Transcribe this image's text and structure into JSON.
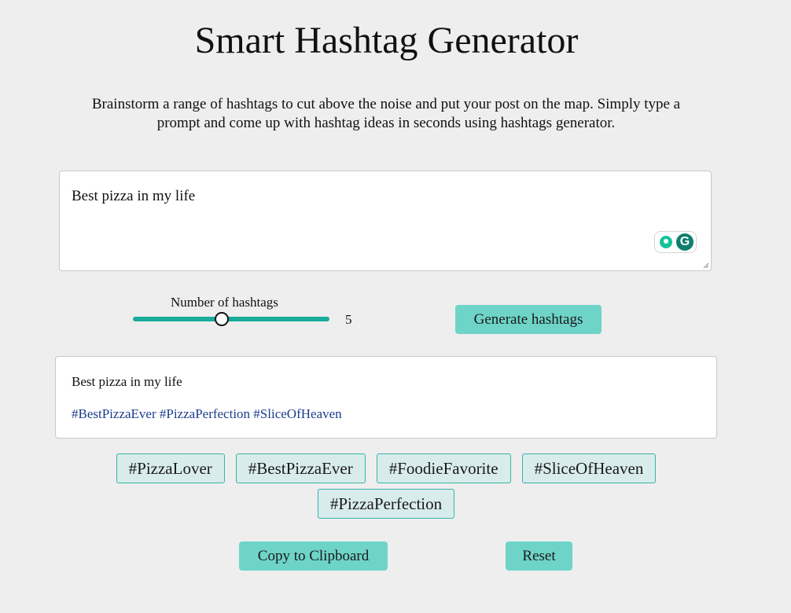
{
  "header": {
    "title": "Smart Hashtag Generator",
    "description": "Brainstorm a range of hashtags to cut above the noise and put your post on the map. Simply type a prompt and come up with hashtag ideas in seconds using hashtags generator."
  },
  "prompt": {
    "value": "Best pizza in my life",
    "grammarly_icons": [
      "lightbulb-icon",
      "grammarly-g-icon"
    ]
  },
  "slider": {
    "label": "Number of hashtags",
    "value": "5",
    "fraction": 0.45
  },
  "buttons": {
    "generate_label": "Generate hashtags",
    "copy_label": "Copy to Clipboard",
    "reset_label": "Reset"
  },
  "result": {
    "prompt": "Best pizza in my life",
    "tags": "#BestPizzaEver #PizzaPerfection #SliceOfHeaven"
  },
  "hashtags": [
    "#PizzaLover",
    "#BestPizzaEver",
    "#FoodieFavorite",
    "#SliceOfHeaven",
    "#PizzaPerfection"
  ],
  "colors": {
    "background": "#eeeeee",
    "accent": "#6ed4c8",
    "slider_track": "#1aab9a",
    "chip_background": "#d8eceb",
    "chip_border": "#38b4a8",
    "tag_text": "#1c3d8c"
  }
}
